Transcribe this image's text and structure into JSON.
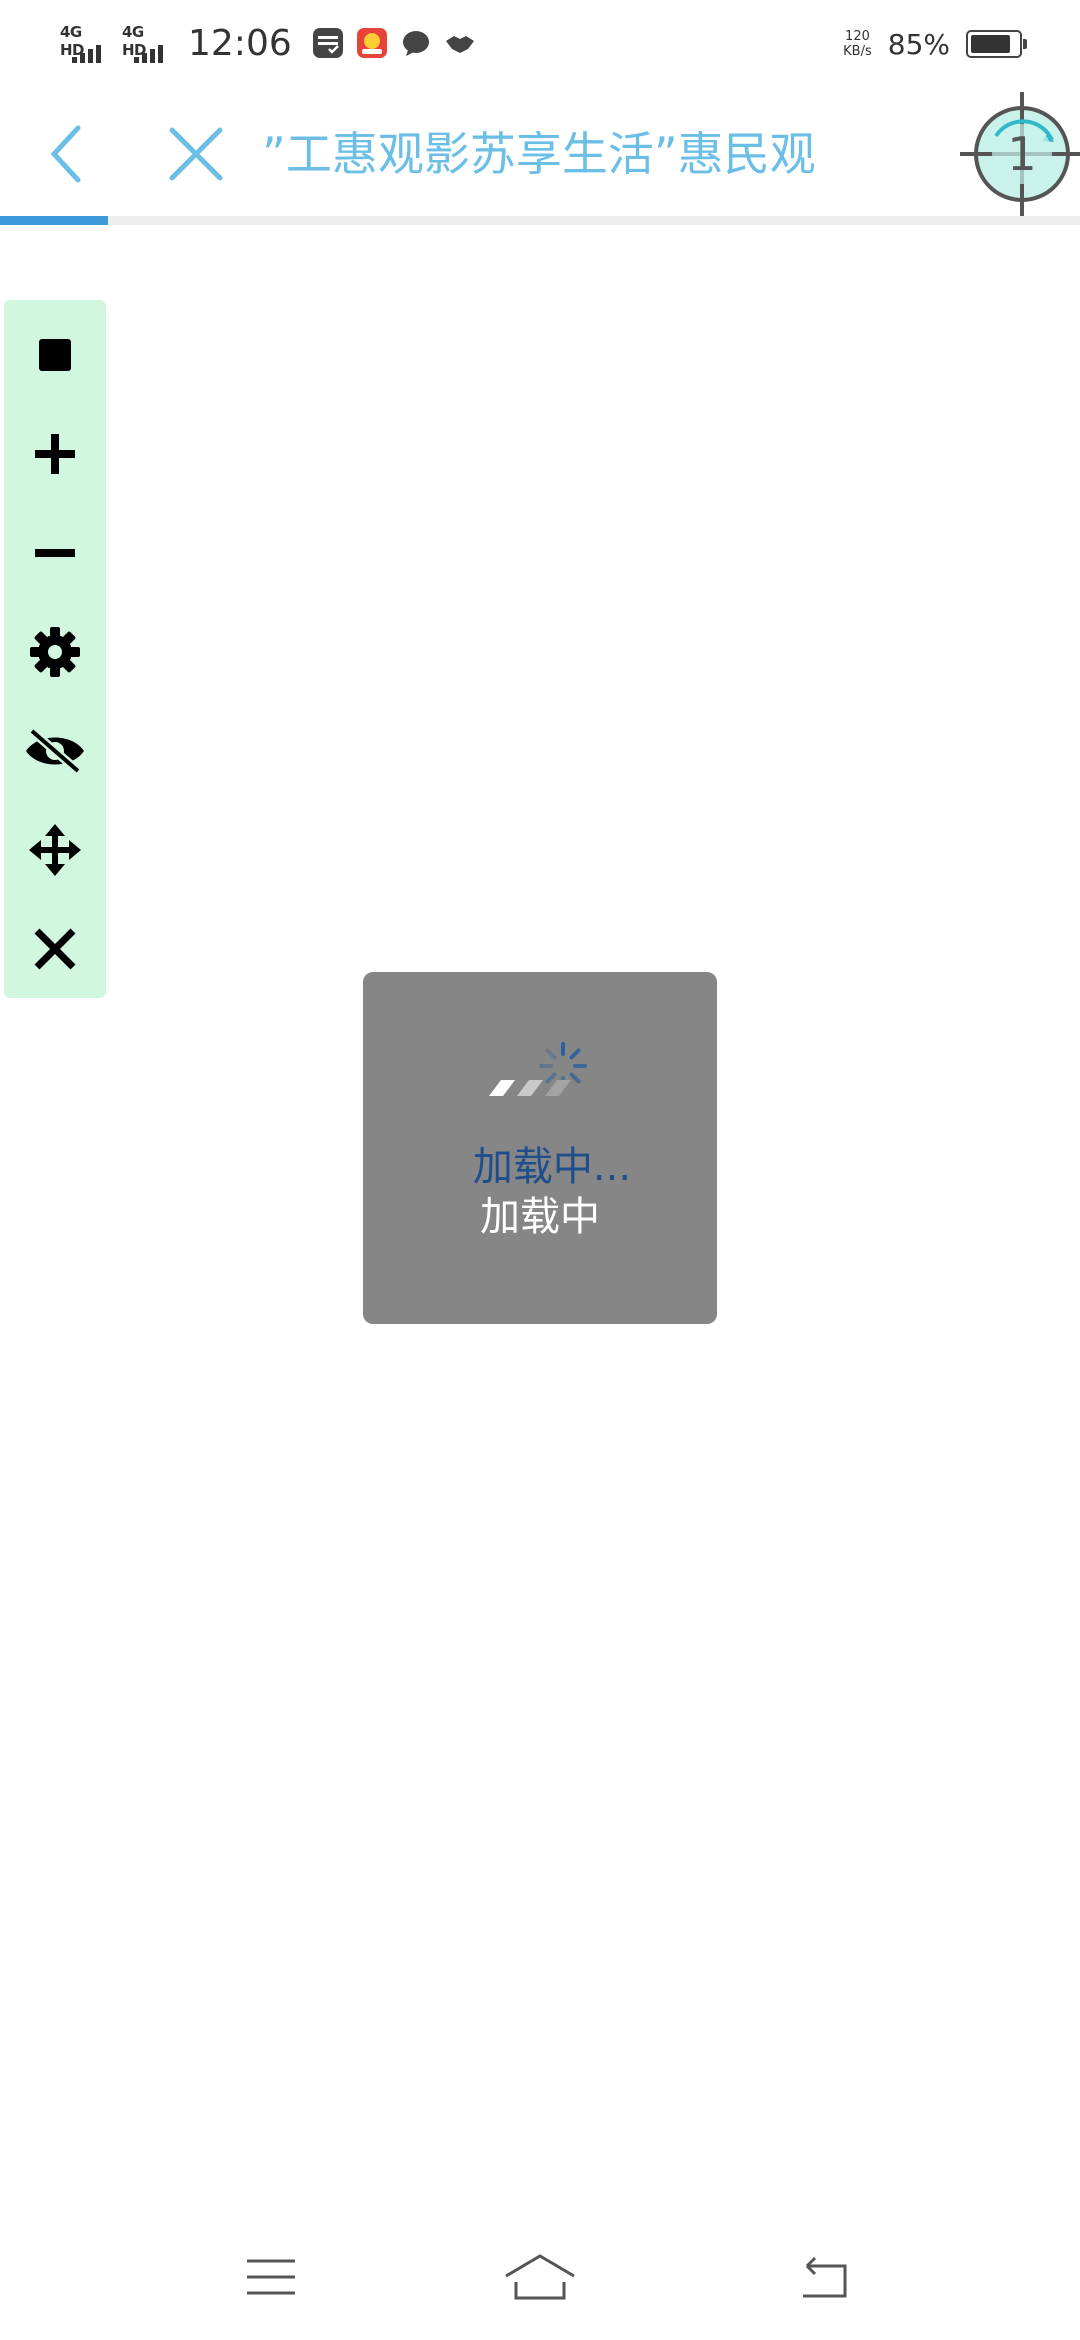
{
  "status_bar": {
    "signal_1": "4G HD",
    "signal_2": "4G HD",
    "time": "12:06",
    "net_speed_value": "120",
    "net_speed_unit": "KB/s",
    "battery_percent": "85%",
    "battery_level": 0.85
  },
  "toolbar": {
    "title": "”工惠观影苏享生活”惠民观",
    "target_badge": "1",
    "load_progress": 0.1
  },
  "tool_panel": {
    "items": [
      {
        "icon": "stop-icon"
      },
      {
        "icon": "zoom-in-icon"
      },
      {
        "icon": "zoom-out-icon"
      },
      {
        "icon": "settings-icon"
      },
      {
        "icon": "hide-icon"
      },
      {
        "icon": "move-icon"
      },
      {
        "icon": "close-icon"
      }
    ]
  },
  "loading": {
    "text_primary": "加载中...",
    "text_secondary": "加载中"
  },
  "nav_bar": {
    "menu": "menu-icon",
    "home": "home-icon",
    "back": "back-icon"
  },
  "colors": {
    "accent": "#6bbfe6",
    "progress": "#3d9bd9",
    "panel_bg": "#d2f7e0",
    "loading_bg": "#868686"
  }
}
